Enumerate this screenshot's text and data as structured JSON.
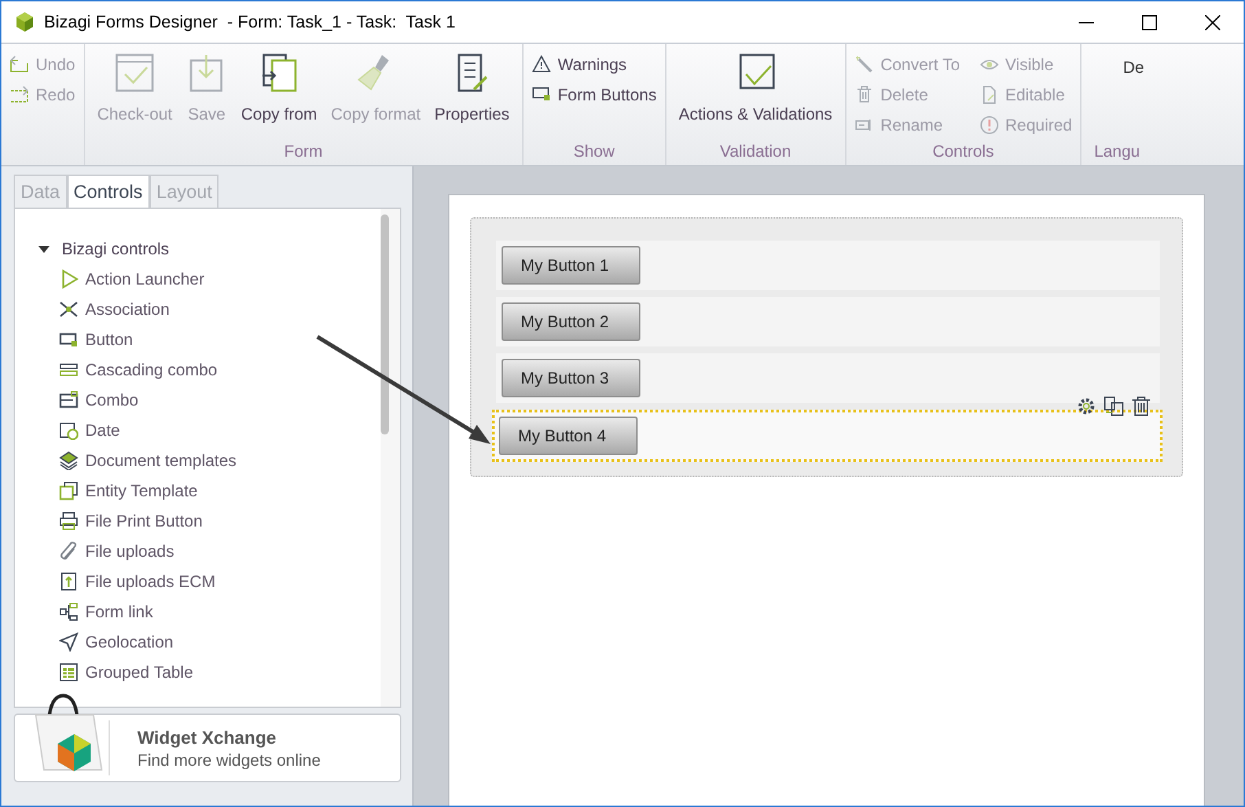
{
  "window": {
    "title": "Bizagi Forms Designer  - Form: Task_1 - Task:  Task 1"
  },
  "ribbon": {
    "groups": [
      {
        "items": [
          {
            "kind": "small",
            "label": "Undo",
            "disabled": true
          },
          {
            "kind": "small",
            "label": "Redo",
            "disabled": true
          }
        ]
      },
      {
        "label": "Form",
        "items": [
          {
            "kind": "large",
            "label": "Check-out",
            "disabled": true
          },
          {
            "kind": "large",
            "label": "Save",
            "disabled": true
          },
          {
            "kind": "large",
            "label": "Copy from",
            "disabled": false
          },
          {
            "kind": "large",
            "label": "Copy format",
            "disabled": true
          },
          {
            "kind": "large",
            "label": "Properties",
            "disabled": false
          }
        ]
      },
      {
        "label": "Show",
        "items": [
          {
            "kind": "small",
            "label": "Warnings",
            "disabled": false
          },
          {
            "kind": "small",
            "label": "Form Buttons",
            "disabled": false
          }
        ]
      },
      {
        "label": "Validation",
        "items": [
          {
            "kind": "large",
            "label": "Actions & Validations",
            "disabled": false
          }
        ]
      },
      {
        "label": "Controls",
        "items": [
          {
            "kind": "small",
            "label": "Convert To",
            "disabled": true
          },
          {
            "kind": "small",
            "label": "Delete",
            "disabled": true
          },
          {
            "kind": "small",
            "label": "Rename",
            "disabled": true
          },
          {
            "kind": "small",
            "label": "Visible",
            "disabled": true
          },
          {
            "kind": "small",
            "label": "Editable",
            "disabled": true
          },
          {
            "kind": "small",
            "label": "Required",
            "disabled": true
          }
        ]
      },
      {
        "label": "Langu",
        "items": [
          {
            "kind": "text",
            "label": "De"
          }
        ]
      }
    ]
  },
  "tabs": [
    {
      "label": "Data",
      "selected": false
    },
    {
      "label": "Controls",
      "selected": true
    },
    {
      "label": "Layout",
      "selected": false
    }
  ],
  "tree": {
    "label": "Bizagi controls",
    "expanded": true,
    "children": [
      {
        "label": "Action Launcher"
      },
      {
        "label": "Association"
      },
      {
        "label": "Button"
      },
      {
        "label": "Cascading combo"
      },
      {
        "label": "Combo"
      },
      {
        "label": "Date"
      },
      {
        "label": "Document templates"
      },
      {
        "label": "Entity Template"
      },
      {
        "label": "File Print Button"
      },
      {
        "label": "File uploads"
      },
      {
        "label": "File uploads ECM"
      },
      {
        "label": "Form link"
      },
      {
        "label": "Geolocation"
      },
      {
        "label": "Grouped Table"
      }
    ]
  },
  "widget_xchange": {
    "title": "Widget Xchange",
    "subtitle": "Find more widgets online"
  },
  "form": {
    "rows": [
      {
        "button": "My Button 1",
        "selected": false
      },
      {
        "button": "My Button 2",
        "selected": false
      },
      {
        "button": "My Button 3",
        "selected": false
      },
      {
        "button": "My Button 4",
        "selected": true
      }
    ]
  }
}
